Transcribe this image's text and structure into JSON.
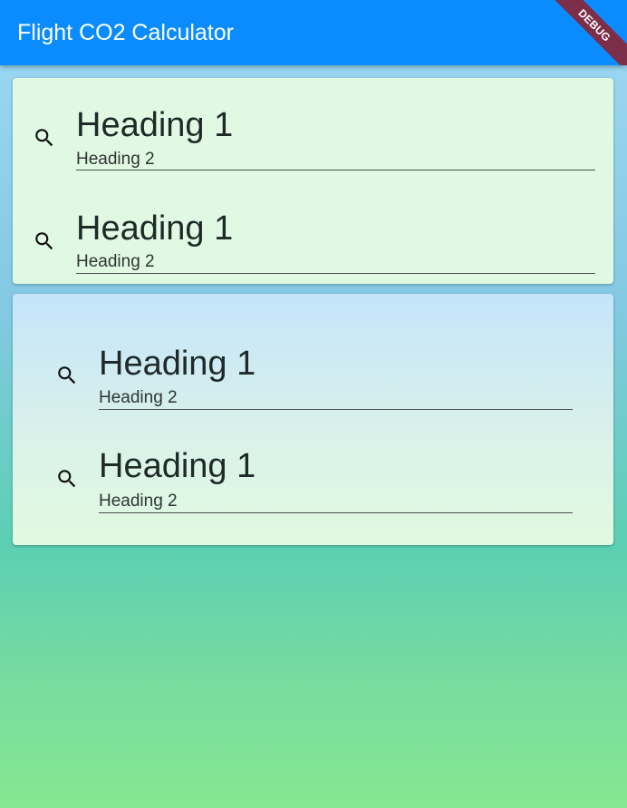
{
  "app_bar": {
    "title": "Flight CO2 Calculator",
    "debug_banner": "DEBUG",
    "background_color": "#0a8cff"
  },
  "card_top": {
    "fields": [
      {
        "icon": "search-icon",
        "heading1": "Heading 1",
        "heading2": "Heading 2"
      },
      {
        "icon": "search-icon",
        "heading1": "Heading 1",
        "heading2": "Heading 2"
      }
    ]
  },
  "card_bottom": {
    "fields": [
      {
        "icon": "search-icon",
        "heading1": "Heading 1",
        "heading2": "Heading 2"
      },
      {
        "icon": "search-icon",
        "heading1": "Heading 1",
        "heading2": "Heading 2"
      }
    ]
  },
  "colors": {
    "debug_banner": "#7c2e48",
    "card_top_background": "#e1f9e3",
    "background_bottom": "#85e891"
  }
}
